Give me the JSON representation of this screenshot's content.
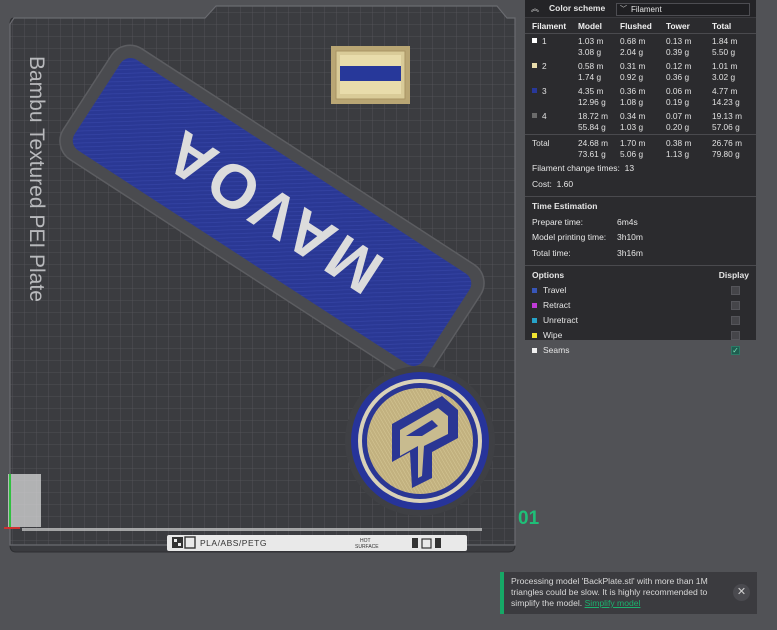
{
  "plate": {
    "name_vertical": "Bambu Textured PEI Plate",
    "bar_text": "PLA/ABS/PETG",
    "hot_surface_line1": "HOT",
    "hot_surface_line2": "SURFACE",
    "plate_number": "01"
  },
  "models": {
    "nameplate_text": "MAVOA"
  },
  "panel": {
    "color_scheme_label": "Color scheme",
    "color_scheme_value": "Filament",
    "headers": [
      "Filament",
      "Model",
      "Flushed",
      "Tower",
      "Total"
    ],
    "rows": [
      {
        "id": "1",
        "color": "#ffffff",
        "model_m": "1.03 m",
        "model_g": "3.08 g",
        "flushed_m": "0.68 m",
        "flushed_g": "2.04 g",
        "tower_m": "0.13 m",
        "tower_g": "0.39 g",
        "total_m": "1.84 m",
        "total_g": "5.50 g"
      },
      {
        "id": "2",
        "color": "#e8dcab",
        "model_m": "0.58 m",
        "model_g": "1.74 g",
        "flushed_m": "0.31 m",
        "flushed_g": "0.92 g",
        "tower_m": "0.12 m",
        "tower_g": "0.36 g",
        "total_m": "1.01 m",
        "total_g": "3.02 g"
      },
      {
        "id": "3",
        "color": "#28389a",
        "model_m": "4.35 m",
        "model_g": "12.96 g",
        "flushed_m": "0.36 m",
        "flushed_g": "1.08 g",
        "tower_m": "0.06 m",
        "tower_g": "0.19 g",
        "total_m": "4.77 m",
        "total_g": "14.23 g"
      },
      {
        "id": "4",
        "color": "#6b6b6b",
        "model_m": "18.72 m",
        "model_g": "55.84 g",
        "flushed_m": "0.34 m",
        "flushed_g": "1.03 g",
        "tower_m": "0.07 m",
        "tower_g": "0.20 g",
        "total_m": "19.13 m",
        "total_g": "57.06 g"
      }
    ],
    "total": {
      "label": "Total",
      "model_m": "24.68 m",
      "model_g": "73.61 g",
      "flushed_m": "1.70 m",
      "flushed_g": "5.06 g",
      "tower_m": "0.38 m",
      "tower_g": "1.13 g",
      "total_m": "26.76 m",
      "total_g": "79.80 g"
    },
    "filament_change_label": "Filament change times:",
    "filament_change_value": "13",
    "cost_label": "Cost:",
    "cost_value": "1.60",
    "time_estimation_title": "Time Estimation",
    "prepare_label": "Prepare time:",
    "prepare_value": "6m4s",
    "printing_label": "Model printing time:",
    "printing_value": "3h10m",
    "total_time_label": "Total time:",
    "total_time_value": "3h16m",
    "options_label": "Options",
    "display_label": "Display",
    "options": [
      {
        "label": "Travel",
        "color": "#3856b8",
        "checked": false
      },
      {
        "label": "Retract",
        "color": "#c13bd8",
        "checked": false
      },
      {
        "label": "Unretract",
        "color": "#27a3c9",
        "checked": false
      },
      {
        "label": "Wipe",
        "color": "#f2e531",
        "checked": false
      },
      {
        "label": "Seams",
        "color": "#f0f0f0",
        "checked": true
      }
    ]
  },
  "notification": {
    "message": "Processing model 'BackPlate.stl' with more than 1M triangles could be slow. It is highly recommended to simplify the model.",
    "link": "Simplify model",
    "close_symbol": "✕"
  }
}
